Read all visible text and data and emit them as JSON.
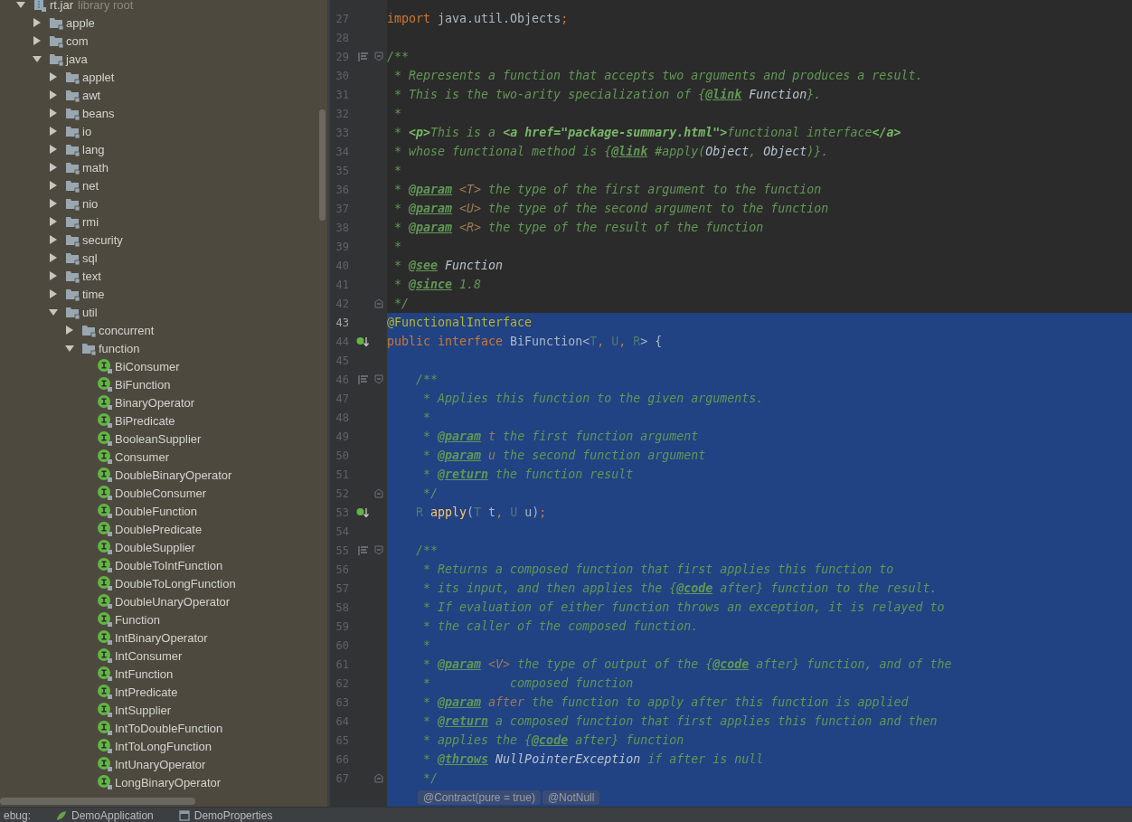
{
  "project_tree": {
    "items": [
      {
        "kind": "jar",
        "label": "rt.jar",
        "hint": "library root",
        "expanded": true,
        "children": [
          {
            "kind": "package",
            "label": "apple",
            "expanded": false
          },
          {
            "kind": "package",
            "label": "com",
            "expanded": false
          },
          {
            "kind": "package",
            "label": "java",
            "expanded": true,
            "children": [
              {
                "kind": "package",
                "label": "applet",
                "expanded": false
              },
              {
                "kind": "package",
                "label": "awt",
                "expanded": false
              },
              {
                "kind": "package",
                "label": "beans",
                "expanded": false
              },
              {
                "kind": "package",
                "label": "io",
                "expanded": false
              },
              {
                "kind": "package",
                "label": "lang",
                "expanded": false
              },
              {
                "kind": "package",
                "label": "math",
                "expanded": false
              },
              {
                "kind": "package",
                "label": "net",
                "expanded": false
              },
              {
                "kind": "package",
                "label": "nio",
                "expanded": false
              },
              {
                "kind": "package",
                "label": "rmi",
                "expanded": false
              },
              {
                "kind": "package",
                "label": "security",
                "expanded": false
              },
              {
                "kind": "package",
                "label": "sql",
                "expanded": false
              },
              {
                "kind": "package",
                "label": "text",
                "expanded": false
              },
              {
                "kind": "package",
                "label": "time",
                "expanded": false
              },
              {
                "kind": "package",
                "label": "util",
                "expanded": true,
                "children": [
                  {
                    "kind": "package",
                    "label": "concurrent",
                    "expanded": false
                  },
                  {
                    "kind": "package",
                    "label": "function",
                    "expanded": true,
                    "children": [
                      {
                        "kind": "interface",
                        "label": "BiConsumer"
                      },
                      {
                        "kind": "interface",
                        "label": "BiFunction"
                      },
                      {
                        "kind": "interface",
                        "label": "BinaryOperator"
                      },
                      {
                        "kind": "interface",
                        "label": "BiPredicate"
                      },
                      {
                        "kind": "interface",
                        "label": "BooleanSupplier"
                      },
                      {
                        "kind": "interface",
                        "label": "Consumer"
                      },
                      {
                        "kind": "interface",
                        "label": "DoubleBinaryOperator"
                      },
                      {
                        "kind": "interface",
                        "label": "DoubleConsumer"
                      },
                      {
                        "kind": "interface",
                        "label": "DoubleFunction"
                      },
                      {
                        "kind": "interface",
                        "label": "DoublePredicate"
                      },
                      {
                        "kind": "interface",
                        "label": "DoubleSupplier"
                      },
                      {
                        "kind": "interface",
                        "label": "DoubleToIntFunction"
                      },
                      {
                        "kind": "interface",
                        "label": "DoubleToLongFunction"
                      },
                      {
                        "kind": "interface",
                        "label": "DoubleUnaryOperator"
                      },
                      {
                        "kind": "interface",
                        "label": "Function"
                      },
                      {
                        "kind": "interface",
                        "label": "IntBinaryOperator"
                      },
                      {
                        "kind": "interface",
                        "label": "IntConsumer"
                      },
                      {
                        "kind": "interface",
                        "label": "IntFunction"
                      },
                      {
                        "kind": "interface",
                        "label": "IntPredicate"
                      },
                      {
                        "kind": "interface",
                        "label": "IntSupplier"
                      },
                      {
                        "kind": "interface",
                        "label": "IntToDoubleFunction"
                      },
                      {
                        "kind": "interface",
                        "label": "IntToLongFunction"
                      },
                      {
                        "kind": "interface",
                        "label": "IntUnaryOperator"
                      },
                      {
                        "kind": "interface",
                        "label": "LongBinaryOperator"
                      }
                    ]
                  }
                ]
              }
            ]
          }
        ]
      }
    ]
  },
  "editor": {
    "lines": [
      {
        "number": "27",
        "selected": false,
        "segments": [
          {
            "kind": "kw",
            "text": "import "
          },
          {
            "kind": "text",
            "text": "java.util.Objects"
          },
          {
            "kind": "kw",
            "text": ";"
          }
        ]
      },
      {
        "number": "28",
        "selected": false
      },
      {
        "number": "29",
        "selected": false,
        "gutter_icon": {
          "kind": "doc"
        },
        "fold_marker": {
          "kind": "open"
        },
        "segments": [
          {
            "kind": "comment",
            "text": "/**"
          }
        ]
      },
      {
        "number": "30",
        "selected": false,
        "segments": [
          {
            "kind": "comment",
            "text": " * Represents a function that accepts two arguments and produces a result."
          }
        ]
      },
      {
        "number": "31",
        "selected": false,
        "segments": [
          {
            "kind": "comment",
            "text": " * This is the two-arity specialization of {"
          },
          {
            "kind": "doctag",
            "text": "@link"
          },
          {
            "kind": "docref",
            "text": " Function"
          },
          {
            "kind": "comment",
            "text": "}."
          }
        ]
      },
      {
        "number": "32",
        "selected": false,
        "segments": [
          {
            "kind": "comment",
            "text": " *"
          }
        ]
      },
      {
        "number": "33",
        "selected": false,
        "segments": [
          {
            "kind": "comment",
            "text": " * "
          },
          {
            "kind": "html",
            "text": "<p>"
          },
          {
            "kind": "comment",
            "text": "This is a "
          },
          {
            "kind": "html",
            "text": "<a href=\"package-summary.html\">"
          },
          {
            "kind": "comment",
            "text": "functional interface"
          },
          {
            "kind": "html",
            "text": "</a>"
          }
        ]
      },
      {
        "number": "34",
        "selected": false,
        "segments": [
          {
            "kind": "comment",
            "text": " * whose functional method is {"
          },
          {
            "kind": "doctag",
            "text": "@link"
          },
          {
            "kind": "comment",
            "text": " #apply("
          },
          {
            "kind": "docref",
            "text": "Object"
          },
          {
            "kind": "comment",
            "text": ", "
          },
          {
            "kind": "docref",
            "text": "Object"
          },
          {
            "kind": "comment",
            "text": ")}."
          }
        ]
      },
      {
        "number": "35",
        "selected": false,
        "segments": [
          {
            "kind": "comment",
            "text": " *"
          }
        ]
      },
      {
        "number": "36",
        "selected": false,
        "segments": [
          {
            "kind": "comment",
            "text": " * "
          },
          {
            "kind": "doctag",
            "text": "@param"
          },
          {
            "kind": "docparam",
            "text": " <T>"
          },
          {
            "kind": "comment",
            "text": " the type of the first argument to the function"
          }
        ]
      },
      {
        "number": "37",
        "selected": false,
        "segments": [
          {
            "kind": "comment",
            "text": " * "
          },
          {
            "kind": "doctag",
            "text": "@param"
          },
          {
            "kind": "docparam",
            "text": " <U>"
          },
          {
            "kind": "comment",
            "text": " the type of the second argument to the function"
          }
        ]
      },
      {
        "number": "38",
        "selected": false,
        "segments": [
          {
            "kind": "comment",
            "text": " * "
          },
          {
            "kind": "doctag",
            "text": "@param"
          },
          {
            "kind": "docparam",
            "text": " <R>"
          },
          {
            "kind": "comment",
            "text": " the type of the result of the function"
          }
        ]
      },
      {
        "number": "39",
        "selected": false,
        "segments": [
          {
            "kind": "comment",
            "text": " *"
          }
        ]
      },
      {
        "number": "40",
        "selected": false,
        "segments": [
          {
            "kind": "comment",
            "text": " * "
          },
          {
            "kind": "doctag",
            "text": "@see"
          },
          {
            "kind": "docref",
            "text": " Function"
          }
        ]
      },
      {
        "number": "41",
        "selected": false,
        "segments": [
          {
            "kind": "comment",
            "text": " * "
          },
          {
            "kind": "doctag",
            "text": "@since"
          },
          {
            "kind": "comment",
            "text": " 1.8"
          }
        ]
      },
      {
        "number": "42",
        "selected": false,
        "fold_marker": {
          "kind": "close"
        },
        "segments": [
          {
            "kind": "comment",
            "text": " */"
          }
        ]
      },
      {
        "number": "43",
        "selected": true,
        "current": true,
        "segments": [
          {
            "kind": "annotation",
            "text": "@FunctionalInterface"
          }
        ]
      },
      {
        "number": "44",
        "selected": true,
        "gutter_icon": {
          "kind": "impl"
        },
        "segments": [
          {
            "kind": "kw",
            "text": "public interface "
          },
          {
            "kind": "text",
            "text": "BiFunction<"
          },
          {
            "kind": "typeparam",
            "text": "T"
          },
          {
            "kind": "kw",
            "text": ", "
          },
          {
            "kind": "typeparam",
            "text": "U"
          },
          {
            "kind": "kw",
            "text": ", "
          },
          {
            "kind": "typeparam",
            "text": "R"
          },
          {
            "kind": "text",
            "text": "> {"
          }
        ]
      },
      {
        "number": "45",
        "selected": true
      },
      {
        "number": "46",
        "selected": true,
        "gutter_icon": {
          "kind": "doc"
        },
        "fold_marker": {
          "kind": "open"
        },
        "segments": [
          {
            "kind": "comment",
            "text": "    /**"
          }
        ]
      },
      {
        "number": "47",
        "selected": true,
        "segments": [
          {
            "kind": "comment",
            "text": "     * Applies this function to the given arguments."
          }
        ]
      },
      {
        "number": "48",
        "selected": true,
        "segments": [
          {
            "kind": "comment",
            "text": "     *"
          }
        ]
      },
      {
        "number": "49",
        "selected": true,
        "segments": [
          {
            "kind": "comment",
            "text": "     * "
          },
          {
            "kind": "doctag",
            "text": "@param"
          },
          {
            "kind": "docparam",
            "text": " t"
          },
          {
            "kind": "comment",
            "text": " the first function argument"
          }
        ]
      },
      {
        "number": "50",
        "selected": true,
        "segments": [
          {
            "kind": "comment",
            "text": "     * "
          },
          {
            "kind": "doctag",
            "text": "@param"
          },
          {
            "kind": "docparam",
            "text": " u"
          },
          {
            "kind": "comment",
            "text": " the second function argument"
          }
        ]
      },
      {
        "number": "51",
        "selected": true,
        "segments": [
          {
            "kind": "comment",
            "text": "     * "
          },
          {
            "kind": "doctag",
            "text": "@return"
          },
          {
            "kind": "comment",
            "text": " the function result"
          }
        ]
      },
      {
        "number": "52",
        "selected": true,
        "fold_marker": {
          "kind": "close"
        },
        "segments": [
          {
            "kind": "comment",
            "text": "     */"
          }
        ]
      },
      {
        "number": "53",
        "selected": true,
        "gutter_icon": {
          "kind": "impl"
        },
        "segments": [
          {
            "kind": "typeparam",
            "text": "    R"
          },
          {
            "kind": "method",
            "text": " apply"
          },
          {
            "kind": "text",
            "text": "("
          },
          {
            "kind": "typeparam",
            "text": "T"
          },
          {
            "kind": "text",
            "text": " t"
          },
          {
            "kind": "kw",
            "text": ", "
          },
          {
            "kind": "typeparam",
            "text": "U"
          },
          {
            "kind": "text",
            "text": " u)"
          },
          {
            "kind": "kw",
            "text": ";"
          }
        ]
      },
      {
        "number": "54",
        "selected": true
      },
      {
        "number": "55",
        "selected": true,
        "gutter_icon": {
          "kind": "doc"
        },
        "fold_marker": {
          "kind": "open"
        },
        "segments": [
          {
            "kind": "comment",
            "text": "    /**"
          }
        ]
      },
      {
        "number": "56",
        "selected": true,
        "segments": [
          {
            "kind": "comment",
            "text": "     * Returns a composed function that first applies this function to"
          }
        ]
      },
      {
        "number": "57",
        "selected": true,
        "segments": [
          {
            "kind": "comment",
            "text": "     * its input, and then applies the {"
          },
          {
            "kind": "doctag",
            "text": "@code"
          },
          {
            "kind": "comment",
            "text": " after} function to the result."
          }
        ]
      },
      {
        "number": "58",
        "selected": true,
        "segments": [
          {
            "kind": "comment",
            "text": "     * If evaluation of either function throws an exception, it is relayed to"
          }
        ]
      },
      {
        "number": "59",
        "selected": true,
        "segments": [
          {
            "kind": "comment",
            "text": "     * the caller of the composed function."
          }
        ]
      },
      {
        "number": "60",
        "selected": true,
        "segments": [
          {
            "kind": "comment",
            "text": "     *"
          }
        ]
      },
      {
        "number": "61",
        "selected": true,
        "segments": [
          {
            "kind": "comment",
            "text": "     * "
          },
          {
            "kind": "doctag",
            "text": "@param"
          },
          {
            "kind": "docparam",
            "text": " <V>"
          },
          {
            "kind": "comment",
            "text": " the type of output of the {"
          },
          {
            "kind": "doctag",
            "text": "@code"
          },
          {
            "kind": "comment",
            "text": " after} function, and of the"
          }
        ]
      },
      {
        "number": "62",
        "selected": true,
        "segments": [
          {
            "kind": "comment",
            "text": "     *           composed function"
          }
        ]
      },
      {
        "number": "63",
        "selected": true,
        "segments": [
          {
            "kind": "comment",
            "text": "     * "
          },
          {
            "kind": "doctag",
            "text": "@param"
          },
          {
            "kind": "docparam",
            "text": " after"
          },
          {
            "kind": "comment",
            "text": " the function to apply after this function is applied"
          }
        ]
      },
      {
        "number": "64",
        "selected": true,
        "segments": [
          {
            "kind": "comment",
            "text": "     * "
          },
          {
            "kind": "doctag",
            "text": "@return"
          },
          {
            "kind": "comment",
            "text": " a composed function that first applies this function and then"
          }
        ]
      },
      {
        "number": "65",
        "selected": true,
        "segments": [
          {
            "kind": "comment",
            "text": "     * applies the {"
          },
          {
            "kind": "doctag",
            "text": "@code"
          },
          {
            "kind": "comment",
            "text": " after} function"
          }
        ]
      },
      {
        "number": "66",
        "selected": true,
        "segments": [
          {
            "kind": "comment",
            "text": "     * "
          },
          {
            "kind": "doctag",
            "text": "@throws"
          },
          {
            "kind": "docref",
            "text": " NullPointerException"
          },
          {
            "kind": "comment",
            "text": " if after is null"
          }
        ]
      },
      {
        "number": "67",
        "selected": true,
        "fold_marker": {
          "kind": "close"
        },
        "segments": [
          {
            "kind": "comment",
            "text": "     */"
          }
        ]
      }
    ],
    "inlay_hints": [
      "@Contract(pure = true)",
      "@NotNull"
    ]
  },
  "bottom_tabs": [
    {
      "label": "ebug:",
      "kind": "tool"
    },
    {
      "label": "DemoApplication",
      "kind": "run"
    },
    {
      "label": "DemoProperties",
      "kind": "config"
    }
  ]
}
